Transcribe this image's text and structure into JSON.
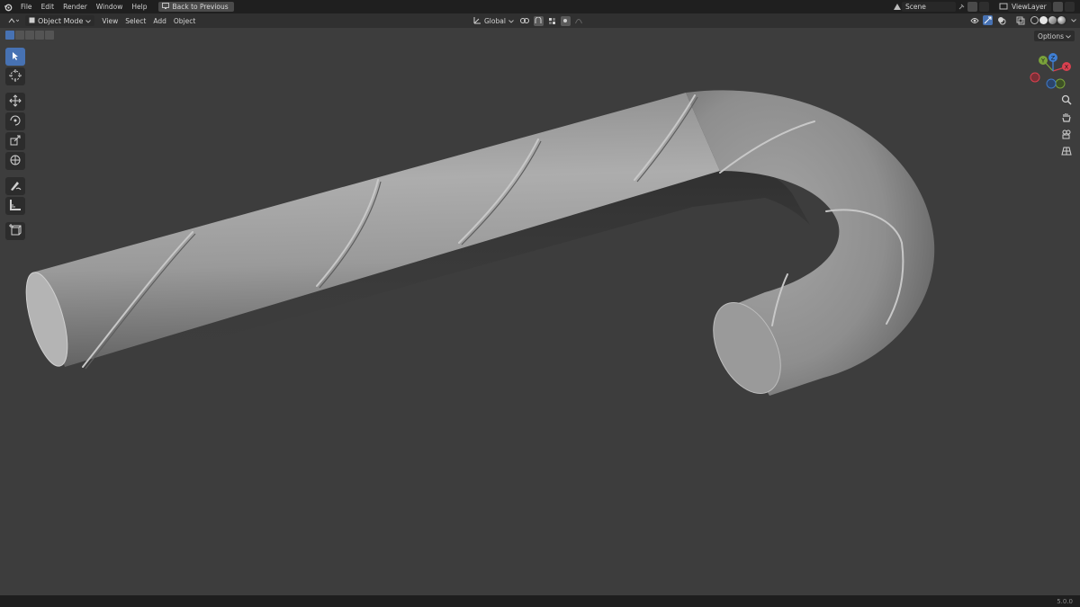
{
  "topbar": {
    "menu": [
      "File",
      "Edit",
      "Render",
      "Window",
      "Help"
    ],
    "back_button": "Back to Previous",
    "scene": "Scene",
    "view_layer": "ViewLayer"
  },
  "header": {
    "mode": "Object Mode",
    "menus": [
      "View",
      "Select",
      "Add",
      "Object"
    ],
    "orientation": "Global",
    "options": "Options"
  },
  "gizmo": {
    "x": "X",
    "y": "Y",
    "z": "Z"
  },
  "status": {
    "version": "5.0.0"
  },
  "colors": {
    "viewport": "#3d3d3d",
    "topbar": "#1f1f1f",
    "accent": "#4772b3",
    "gizmo_x": "#d9404f",
    "gizmo_y": "#7aa23a",
    "gizmo_z": "#3f7fd4"
  }
}
